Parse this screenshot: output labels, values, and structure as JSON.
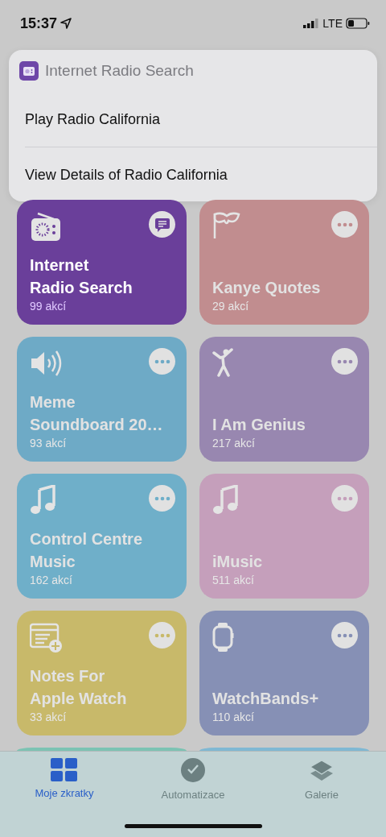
{
  "status_bar": {
    "time": "15:37",
    "network": "LTE"
  },
  "menu": {
    "title": "Internet Radio Search",
    "items": [
      {
        "label": "Play Radio California"
      },
      {
        "label": "View Details of Radio California"
      }
    ]
  },
  "cards": [
    {
      "title": "Internet\nRadio Search",
      "count": "99 akcí",
      "color": "#6a3f9a",
      "selected": true
    },
    {
      "title": "Kanye Quotes",
      "count": "29 akcí",
      "color": "#c18d8f",
      "selected": false
    },
    {
      "title": "Meme\nSoundboard 20…",
      "count": "93 akcí",
      "color": "#6eaac6",
      "selected": false
    },
    {
      "title": "I Am Genius",
      "count": "217 akcí",
      "color": "#9887b0",
      "selected": false
    },
    {
      "title": "Control Centre\nMusic",
      "count": "162 akcí",
      "color": "#6fafc9",
      "selected": false
    },
    {
      "title": "iMusic",
      "count": "511 akcí",
      "color": "#c59fbb",
      "selected": false
    },
    {
      "title": "Notes For\nApple Watch",
      "count": "33 akcí",
      "color": "#c8b96a",
      "selected": false
    },
    {
      "title": "WatchBands+",
      "count": "110 akcí",
      "color": "#8690b5",
      "selected": false
    },
    {
      "color": "#7cc3b3"
    },
    {
      "color": "#7fb8d3"
    }
  ],
  "tabs": [
    {
      "label": "Moje zkratky",
      "selected": true
    },
    {
      "label": "Automatizace",
      "selected": false
    },
    {
      "label": "Galerie",
      "selected": false
    }
  ]
}
